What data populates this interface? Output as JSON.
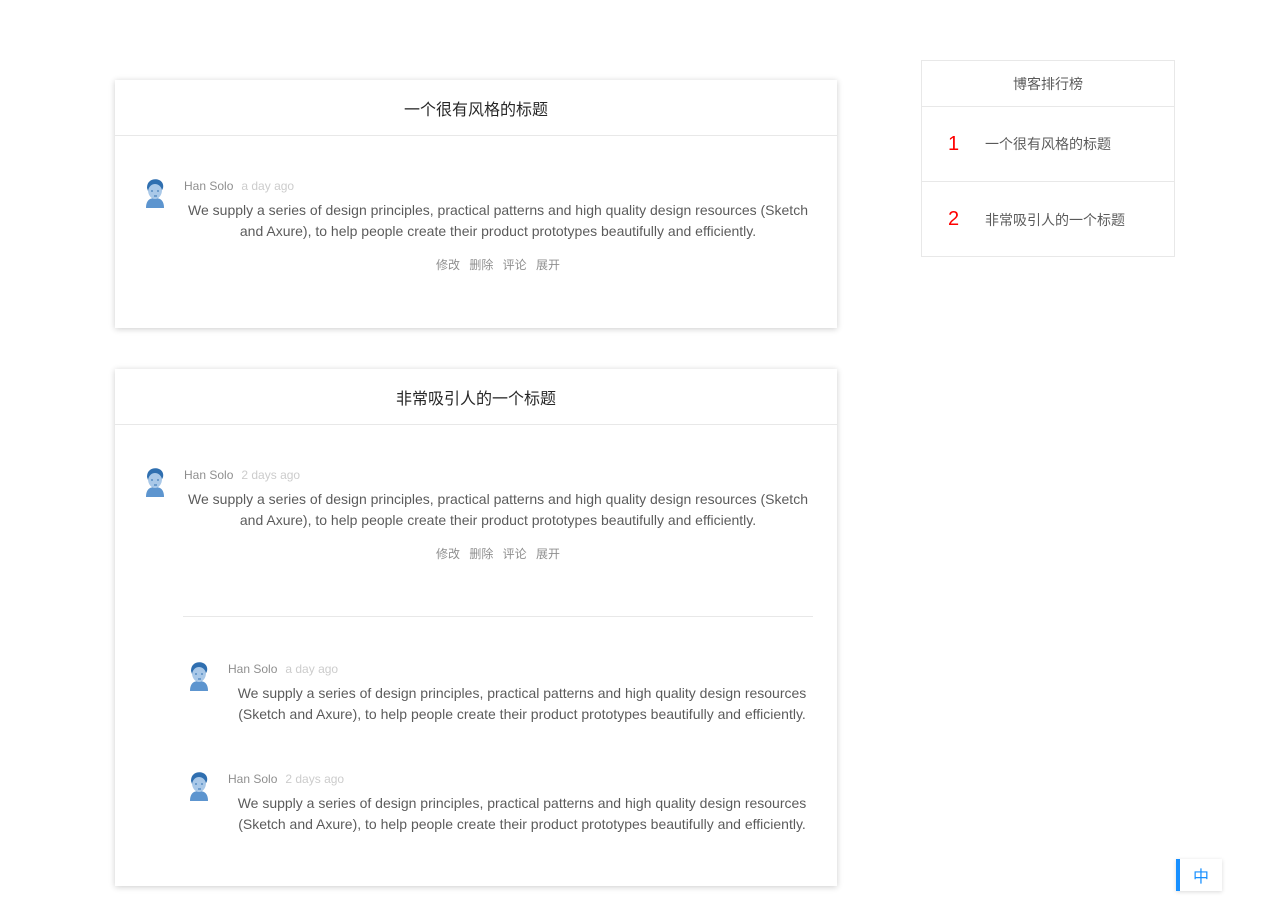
{
  "posts": [
    {
      "title": "一个很有风格的标题",
      "comment": {
        "author": "Han Solo",
        "time": "a day ago",
        "text": "We supply a series of design principles, practical patterns and high quality design resources (Sketch and Axure), to help people create their product prototypes beautifully and efficiently.",
        "actions": [
          "修改",
          "删除",
          "评论",
          "展开"
        ]
      }
    },
    {
      "title": "非常吸引人的一个标题",
      "comment": {
        "author": "Han Solo",
        "time": "2 days ago",
        "text": "We supply a series of design principles, practical patterns and high quality design resources (Sketch and Axure), to help people create their product prototypes beautifully and efficiently.",
        "actions": [
          "修改",
          "删除",
          "评论",
          "展开"
        ]
      },
      "replies": [
        {
          "author": "Han Solo",
          "time": "a day ago",
          "text": "We supply a series of design principles, practical patterns and high quality design resources (Sketch and Axure), to help people create their product prototypes beautifully and efficiently."
        },
        {
          "author": "Han Solo",
          "time": "2 days ago",
          "text": "We supply a series of design principles, practical patterns and high quality design resources (Sketch and Axure), to help people create their product prototypes beautifully and efficiently."
        }
      ]
    }
  ],
  "ranking": {
    "title": "博客排行榜",
    "items": [
      {
        "rank": "1",
        "title": "一个很有风格的标题"
      },
      {
        "rank": "2",
        "title": "非常吸引人的一个标题"
      }
    ]
  },
  "lang_toggle": {
    "label": "中"
  },
  "colors": {
    "accent": "#1890ff",
    "rank_number": "#ff0000",
    "divider": "#e8e8e8",
    "avatar": "#3a7fc2"
  }
}
